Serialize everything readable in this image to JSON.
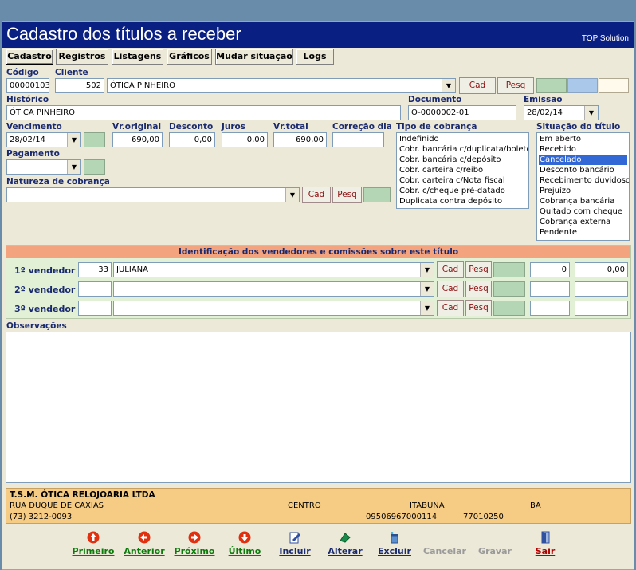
{
  "window": {
    "title": "Cadastro dos títulos a receber",
    "brand": "TOP Solution"
  },
  "tabs": [
    "Cadastro",
    "Registros",
    "Listagens",
    "Gráficos",
    "Mudar situação",
    "Logs"
  ],
  "form": {
    "codigo_label": "Código",
    "codigo": "00000103",
    "cliente_label": "Cliente",
    "cliente_cod": "502",
    "cliente_nome": "ÓTICA PINHEIRO",
    "cad": "Cad",
    "pesq": "Pesq",
    "historico_label": "Histórico",
    "historico": "ÓTICA PINHEIRO",
    "documento_label": "Documento",
    "documento": "O-0000002-01",
    "emissao_label": "Emissão",
    "emissao": "28/02/14",
    "vencimento_label": "Vencimento",
    "vencimento": "28/02/14",
    "vr_original_label": "Vr.original",
    "vr_original": "690,00",
    "desconto_label": "Desconto",
    "desconto": "0,00",
    "juros_label": "Juros",
    "juros": "0,00",
    "vr_total_label": "Vr.total",
    "vr_total": "690,00",
    "correcao_label": "Correção dia",
    "correcao": "",
    "pagamento_label": "Pagamento",
    "pagamento": "",
    "natureza_label": "Natureza de cobrança",
    "natureza": "",
    "tipo_label": "Tipo de cobrança",
    "tipo_options": [
      "Indefinido",
      "Cobr. bancária c/duplicata/boleto",
      "Cobr. bancária c/depósito",
      "Cobr. carteira c/reibo",
      "Cobr. carteira c/Nota fiscal",
      "Cobr. c/cheque pré-datado",
      "Duplicata contra depósito"
    ],
    "situacao_label": "Situação do título",
    "situacao_options": [
      "Em aberto",
      "Recebido",
      "Cancelado",
      "Desconto bancário",
      "Recebimento duvidoso",
      "Prejuízo",
      "Cobrança bancária",
      "Quitado com cheque",
      "Cobrança externa",
      "Pendente"
    ],
    "situacao_selected": "Cancelado"
  },
  "vendedores": {
    "header": "Identificação dos vendedores e comissões sobre este título",
    "rows": [
      {
        "label": "1º vendedor",
        "cod": "33",
        "nome": "JULIANA",
        "pct": "0",
        "valor": "0,00"
      },
      {
        "label": "2º vendedor",
        "cod": "",
        "nome": "",
        "pct": "",
        "valor": ""
      },
      {
        "label": "3º vendedor",
        "cod": "",
        "nome": "",
        "pct": "",
        "valor": ""
      }
    ]
  },
  "obs_label": "Observações",
  "footer": {
    "empresa": "T.S.M. ÓTICA RELOJOARIA LTDA",
    "endereco": "RUA DUQUE DE CAXIAS",
    "bairro": "CENTRO",
    "cidade": "ITABUNA",
    "uf": "BA",
    "telefone": "(73) 3212-0093",
    "cnpj": "09506967000114",
    "cep": "77010250"
  },
  "nav": [
    {
      "label": "Primeiro",
      "icon": "arrow-up-icon",
      "enabled": true
    },
    {
      "label": "Anterior",
      "icon": "arrow-left-icon",
      "enabled": true
    },
    {
      "label": "Próximo",
      "icon": "arrow-right-icon",
      "enabled": true
    },
    {
      "label": "Último",
      "icon": "arrow-down-icon",
      "enabled": true
    },
    {
      "label": "Incluir",
      "icon": "new-doc-icon",
      "enabled": true
    },
    {
      "label": "Alterar",
      "icon": "edit-icon",
      "enabled": true
    },
    {
      "label": "Excluir",
      "icon": "delete-icon",
      "enabled": true
    },
    {
      "label": "Cancelar",
      "icon": "",
      "enabled": false
    },
    {
      "label": "Gravar",
      "icon": "",
      "enabled": false
    },
    {
      "label": "Sair",
      "icon": "exit-icon",
      "enabled": true
    }
  ]
}
